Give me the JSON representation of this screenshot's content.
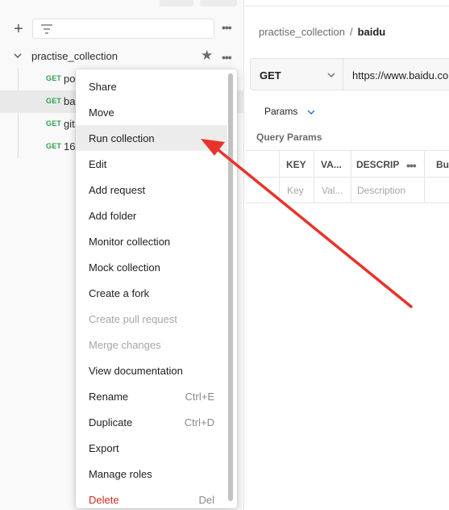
{
  "sidebar": {
    "collection": {
      "name": "practise_collection"
    },
    "requests": [
      {
        "method": "GET",
        "name": "po"
      },
      {
        "method": "GET",
        "name": "ba"
      },
      {
        "method": "GET",
        "name": "git"
      },
      {
        "method": "GET",
        "name": "16"
      }
    ]
  },
  "main": {
    "breadcrumb": {
      "collection": "practise_collection",
      "separator": "/",
      "request": "baidu"
    },
    "request": {
      "method": "GET",
      "url": "https://www.baidu.co"
    },
    "params_tab": "Params",
    "query_params_title": "Query Params",
    "table": {
      "headers": [
        "KEY",
        "VA...",
        "DESCRIP",
        "Bu"
      ],
      "placeholders": [
        "Key",
        "Val...",
        "Description"
      ]
    }
  },
  "context_menu": {
    "items": [
      {
        "label": "Share",
        "shortcut": "",
        "state": "normal"
      },
      {
        "label": "Move",
        "shortcut": "",
        "state": "normal"
      },
      {
        "label": "Run collection",
        "shortcut": "",
        "state": "hover"
      },
      {
        "label": "Edit",
        "shortcut": "",
        "state": "normal"
      },
      {
        "label": "Add request",
        "shortcut": "",
        "state": "normal"
      },
      {
        "label": "Add folder",
        "shortcut": "",
        "state": "normal"
      },
      {
        "label": "Monitor collection",
        "shortcut": "",
        "state": "normal"
      },
      {
        "label": "Mock collection",
        "shortcut": "",
        "state": "normal"
      },
      {
        "label": "Create a fork",
        "shortcut": "",
        "state": "normal"
      },
      {
        "label": "Create pull request",
        "shortcut": "",
        "state": "disabled"
      },
      {
        "label": "Merge changes",
        "shortcut": "",
        "state": "disabled"
      },
      {
        "label": "View documentation",
        "shortcut": "",
        "state": "normal"
      },
      {
        "label": "Rename",
        "shortcut": "Ctrl+E",
        "state": "normal"
      },
      {
        "label": "Duplicate",
        "shortcut": "Ctrl+D",
        "state": "normal"
      },
      {
        "label": "Export",
        "shortcut": "",
        "state": "normal"
      },
      {
        "label": "Manage roles",
        "shortcut": "",
        "state": "normal"
      },
      {
        "label": "Delete",
        "shortcut": "Del",
        "state": "danger"
      }
    ]
  },
  "colors": {
    "method_get": "#2e9e4f",
    "danger": "#d6271f",
    "annotation_arrow": "#e8332b",
    "hover_bg": "#ececec"
  },
  "icons": [
    "plus-icon",
    "filter-icon",
    "chevron-down-icon",
    "star-icon",
    "more-icon"
  ]
}
